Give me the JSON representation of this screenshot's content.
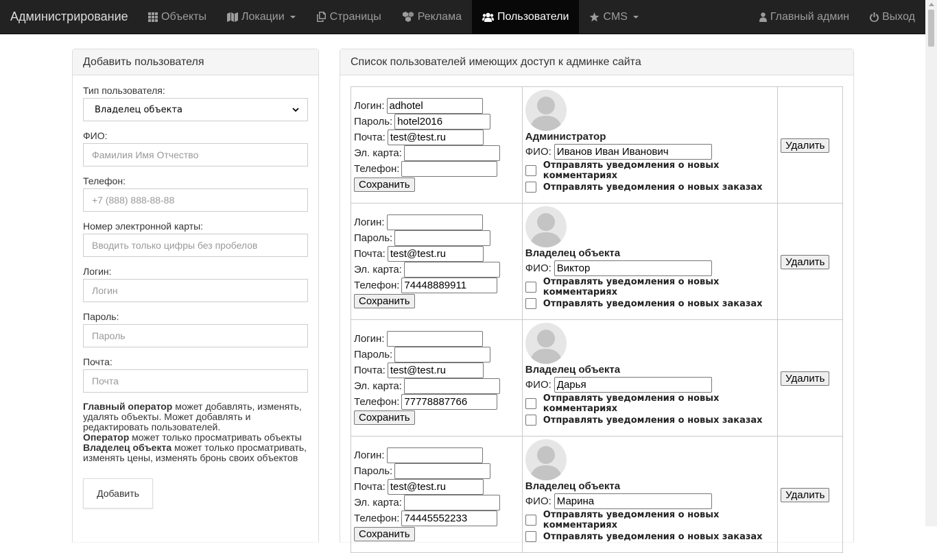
{
  "navbar": {
    "brand": "Администрирование",
    "items": [
      {
        "label": "Объекты",
        "icon": "th-icon",
        "dropdown": false,
        "active": false
      },
      {
        "label": "Локации",
        "icon": "map-icon",
        "dropdown": true,
        "active": false
      },
      {
        "label": "Страницы",
        "icon": "copy-icon",
        "dropdown": false,
        "active": false
      },
      {
        "label": "Реклама",
        "icon": "cubes-icon",
        "dropdown": false,
        "active": false
      },
      {
        "label": "Пользователи",
        "icon": "users-icon",
        "dropdown": false,
        "active": true
      },
      {
        "label": "CMS",
        "icon": "star-icon",
        "dropdown": true,
        "active": false
      }
    ],
    "user_label": "Главный админ",
    "logout_label": "Выход"
  },
  "add_panel": {
    "title": "Добавить пользователя",
    "type_label": "Тип пользователя:",
    "type_value": "Владелец объекта",
    "fio_label": "ФИО:",
    "fio_placeholder": "Фамилия Имя Отчество",
    "phone_label": "Телефон:",
    "phone_placeholder": "+7 (888) 888-88-88",
    "card_label": "Номер электронной карты:",
    "card_placeholder": "Вводить только цифры без пробелов",
    "login_label": "Логин:",
    "login_placeholder": "Логин",
    "password_label": "Пароль:",
    "password_placeholder": "Пароль",
    "email_label": "Почта:",
    "email_placeholder": "Почта",
    "help": {
      "role1": "Главный оператор",
      "text1": " может добавлять, изменять, удалять объекты. Может добавлять и редактировать пользователей.",
      "role2": "Оператор",
      "text2": " может только просматривать объекты",
      "role3": "Владелец объекта",
      "text3": " может только просматривать, изменять цены, изменять бронь своих объектов"
    },
    "add_button": "Добавить"
  },
  "list_panel": {
    "title": "Список пользователей имеющих доступ к админке сайта",
    "labels": {
      "login": "Логин:",
      "password": "Пароль:",
      "email": "Почта:",
      "card": "Эл. карта:",
      "phone": "Телефон:",
      "save": "Сохранить",
      "fio": "ФИО:",
      "notify_comments": "Отправлять уведомления о новых комментариях",
      "notify_orders": "Отправлять уведомления о новых заказах",
      "delete": "Удалить"
    },
    "users": [
      {
        "login": "adhotel",
        "password": "hotel2016",
        "email": "test@test.ru",
        "card": "",
        "phone": "",
        "role": "Администратор",
        "fio": "Иванов Иван Иванович"
      },
      {
        "login": "",
        "password": "",
        "email": "test@test.ru",
        "card": "",
        "phone": "74448889911",
        "role": "Владелец объекта",
        "fio": "Виктор"
      },
      {
        "login": "",
        "password": "",
        "email": "test@test.ru",
        "card": "",
        "phone": "77778887766",
        "role": "Владелец объекта",
        "fio": "Дарья"
      },
      {
        "login": "",
        "password": "",
        "email": "test@test.ru",
        "card": "",
        "phone": "74445552233",
        "role": "Владелец объекта",
        "fio": "Марина"
      }
    ]
  }
}
